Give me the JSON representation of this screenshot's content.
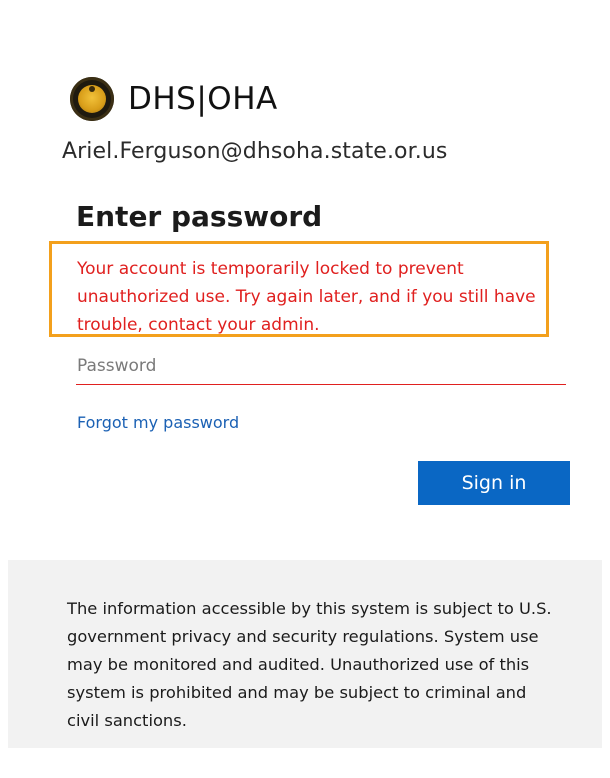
{
  "brand": {
    "name": "DHS|OHA",
    "logo_icon": "state-seal-icon"
  },
  "account": {
    "email": "Ariel.Ferguson@dhsoha.state.or.us"
  },
  "form": {
    "title": "Enter password",
    "error_message": "Your account is temporarily locked to prevent unauthorized use. Try again later, and if you still have trouble, contact your admin.",
    "password_placeholder": "Password",
    "forgot_link": "Forgot my password",
    "sign_in_label": "Sign in"
  },
  "footer": {
    "notice": "The information accessible by this system is subject to U.S. government privacy and security regulations. System use may be monitored and audited. Unauthorized use of this system is prohibited and may be subject to criminal and civil sanctions."
  },
  "colors": {
    "error_red": "#e0201f",
    "highlight_orange": "#f3a01c",
    "button_blue": "#0a67c4",
    "link_blue": "#1b61b4",
    "footer_bg": "#f2f2f2"
  }
}
